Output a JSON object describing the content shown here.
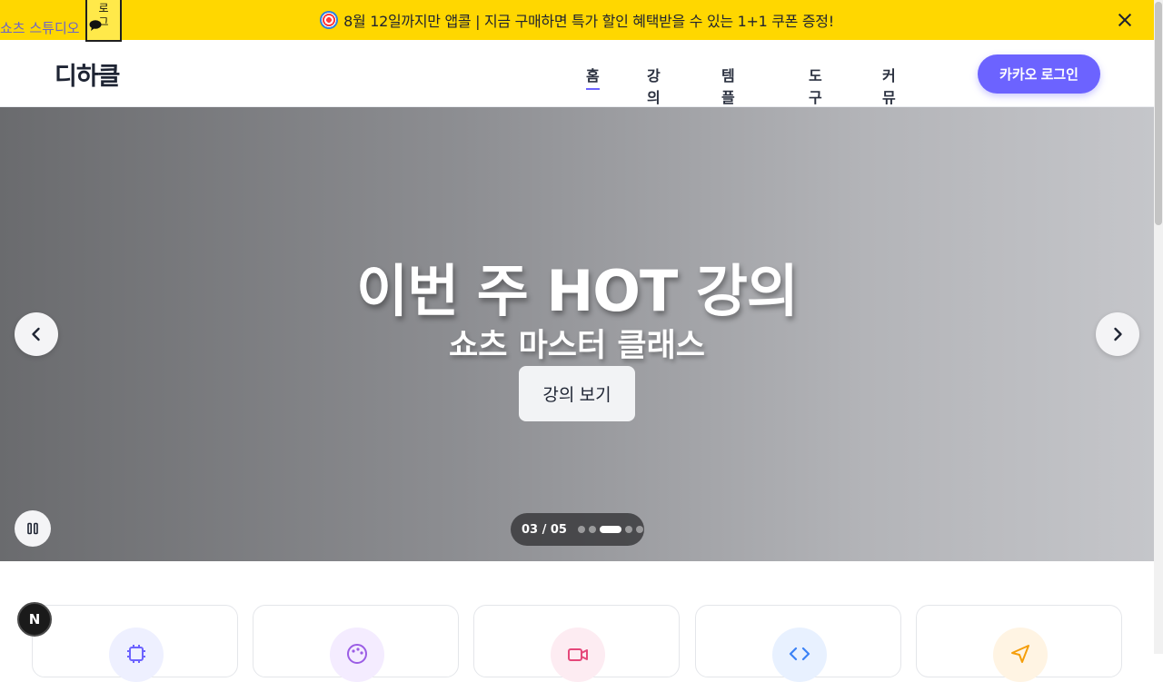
{
  "banner": {
    "text": "8월 12일까지만 앱콜 | 지금 구매하면 특가 할인 혜택받을 수 있는 1+1 쿠폰 증정!",
    "emoji_icon": "target-dart-icon"
  },
  "overlay": {
    "link_text": "쇼츠 스튜디오",
    "box_text": "로그"
  },
  "header": {
    "logo": "디하클",
    "nav": [
      {
        "label": "홈",
        "active": true
      },
      {
        "label": "강의",
        "active": false
      },
      {
        "label": "템플릿",
        "active": false
      },
      {
        "label": "도구",
        "active": false
      },
      {
        "label": "커뮤니티",
        "active": false
      }
    ],
    "login_label": "카카오 로그인"
  },
  "hero": {
    "title": "이번 주 HOT 강의",
    "subtitle": "쇼츠 마스터 클래스",
    "cta_label": "강의 보기",
    "pager_label": "03 / 05",
    "slide_current": 3,
    "slide_total": 5
  },
  "cards": [
    {
      "icon": "chip-icon",
      "color": "#6c63ff",
      "bg": "#eef0ff"
    },
    {
      "icon": "palette-icon",
      "color": "#9b5de5",
      "bg": "#f4ecff"
    },
    {
      "icon": "video-icon",
      "color": "#e5487a",
      "bg": "#fdecf2"
    },
    {
      "icon": "code-icon",
      "color": "#3b82f6",
      "bg": "#e8f1ff"
    },
    {
      "icon": "send-icon",
      "color": "#f59e0b",
      "bg": "#fff4e3"
    }
  ],
  "badge": "N",
  "colors": {
    "banner_bg": "#ffd700",
    "accent": "#6c63ff",
    "text_dark": "#1e2433"
  }
}
